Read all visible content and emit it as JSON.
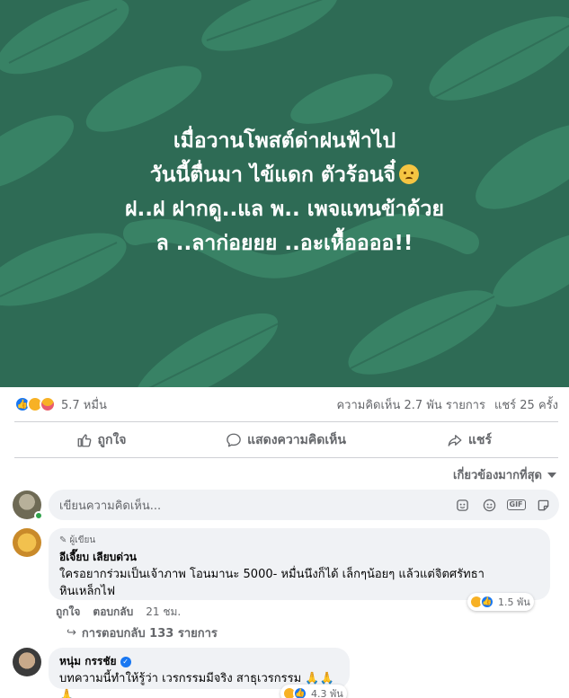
{
  "post": {
    "banner_lines": [
      "เมื่อวานโพสต์ด่าฝนฟ้าไป",
      "วันนี้ตื่นมา ไข้แดก ตัวร้อนจี๋",
      "ฝ..ฝ ฝากดู..แล พ.. เพจแทนข้าด้วย",
      "ล ..ลาก่อยยย ..อะเหื้ออออ!!"
    ],
    "banner_emoji": "sad-face-emoji",
    "banner_color": "#2e6b55"
  },
  "stats": {
    "reaction_count": "5.7 หมื่น",
    "comments": "ความคิดเห็น 2.7 พัน รายการ",
    "shares": "แชร์ 25 ครั้ง"
  },
  "actions": {
    "like": "ถูกใจ",
    "comment": "แสดงความคิดเห็น",
    "share": "แชร์"
  },
  "sort_label": "เกี่ยวข้องมากที่สุด",
  "composer": {
    "placeholder": "เขียนความคิดเห็น..."
  },
  "comments": [
    {
      "badge": "ผู้เขียน",
      "name": "อีเจี๊ยบ เลียบด่วน",
      "text_lines": [
        "ใครอยากร่วมเป็นเจ้าภาพ โอนมานะ 5000- หมื่นนึงก็ได้ เล็กๆน้อยๆ แล้วแต่จิตศรัทธา",
        "หินเหล็กไฟ"
      ],
      "reactions": "1.5 พัน",
      "like": "ถูกใจ",
      "reply": "ตอบกลับ",
      "time": "21 ชม.",
      "replies": "การตอบกลับ 133 รายการ"
    },
    {
      "name": "หนุ่ม กรรชัย",
      "verified": true,
      "text": "บทความนี้ทำให้รู้ว่า เวรกรรมมีจริง สาธุเวรกรรม 🙏🙏🙏",
      "reactions": "4.3 พัน"
    }
  ],
  "colors": {
    "accent": "#1877f2",
    "text_secondary": "#65676b",
    "bubble": "#f0f2f5"
  }
}
